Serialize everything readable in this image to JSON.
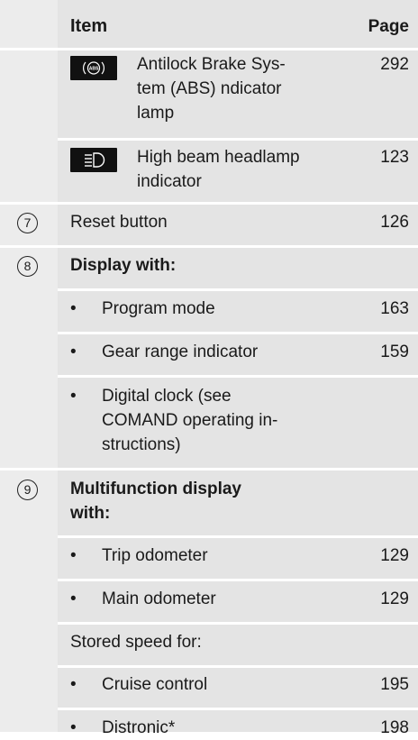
{
  "header": {
    "item": "Item",
    "page": "Page"
  },
  "rows": [
    {
      "text": "Antilock Brake Sys-\ntem (ABS) ndicator\nlamp",
      "page": "292",
      "icon": "abs-indicator-icon"
    },
    {
      "text": "High beam headlamp\nindicator",
      "page": "123",
      "icon": "high-beam-icon"
    },
    {
      "num": "7",
      "text": "Reset button",
      "page": "126"
    },
    {
      "num": "8",
      "text": "Display with:"
    },
    {
      "text": "Program mode",
      "page": "163"
    },
    {
      "text": "Gear range indicator",
      "page": "159"
    },
    {
      "text": "Digital clock (see\nCOMAND operating in-\nstructions)"
    },
    {
      "num": "9",
      "text": "Multifunction display\nwith:"
    },
    {
      "text": "Trip odometer",
      "page": "129"
    },
    {
      "text": "Main odometer",
      "page": "129"
    },
    {
      "text": "Stored speed for:"
    },
    {
      "text": "Cruise control",
      "page": "195"
    },
    {
      "text": "Distronic*",
      "page": "198"
    }
  ],
  "bullet": "•",
  "icons": {
    "abs_label": "ABS"
  }
}
